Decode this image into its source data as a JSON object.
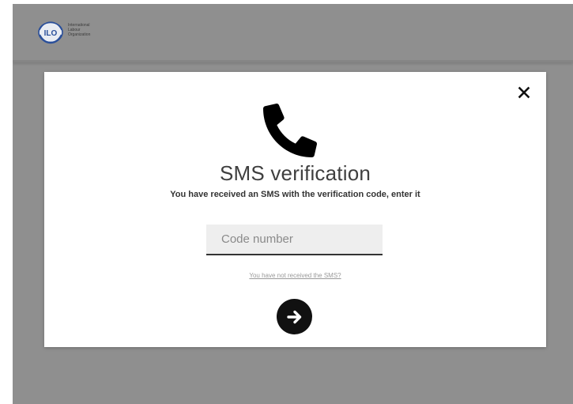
{
  "header": {
    "logo": {
      "emblem_text": "ILO",
      "lines": [
        "International",
        "Labour",
        "Organization"
      ]
    }
  },
  "modal": {
    "title": "SMS verification",
    "subtitle": "You have received an SMS with the verification code, enter it",
    "code_input": {
      "placeholder": "Code number",
      "value": ""
    },
    "resend_link": "You have not received the SMS?",
    "icons": {
      "close": "close-icon",
      "header": "phone-icon",
      "submit": "arrow-right-icon"
    }
  },
  "colors": {
    "backdrop": "#8f8f8f",
    "modal_bg": "#ffffff",
    "input_bg": "#eeeeee",
    "submit_bg": "#111111",
    "logo_blue": "#2a4f9a"
  }
}
